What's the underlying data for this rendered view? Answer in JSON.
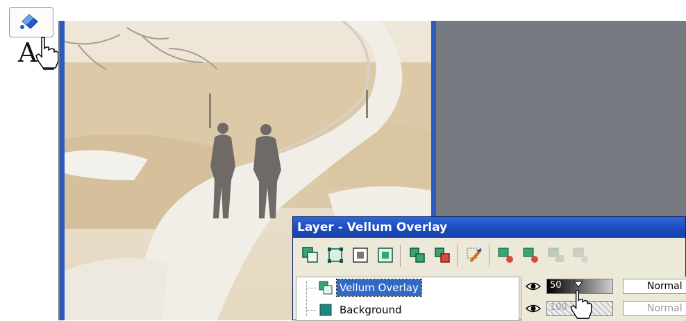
{
  "toolbox": {
    "fill_tool_icon": "paint-bucket-icon",
    "text_tool_glyph": "A",
    "text_tool_icon": "text-tool-icon"
  },
  "photo": {
    "description_icon": "photo-canvas",
    "frame_color": "#2a5bbd"
  },
  "palette": {
    "title": "Layer - Vellum Overlay",
    "toolbar_icons": [
      "new-raster-layer-icon",
      "new-vector-layer-icon",
      "new-mask-layer-icon",
      "new-adjustment-layer-icon",
      "duplicate-layer-icon",
      "delete-layer-icon",
      "edit-selection-icon",
      "link-layer-icon",
      "unlink-layer-icon",
      "merge-layer-icon",
      "group-layer-icon"
    ],
    "layers": [
      {
        "name": "Vellum Overlay",
        "selected": true,
        "opacity": "50",
        "blend": "Normal",
        "thumb_color": "#2a8f6a"
      },
      {
        "name": "Background",
        "selected": false,
        "opacity": "100",
        "blend": "Normal",
        "thumb_color": "#1e8a7e"
      }
    ]
  },
  "colors": {
    "title_bar": "#1b49b8",
    "selection": "#316ac5",
    "canvas_bg": "#767a80"
  }
}
